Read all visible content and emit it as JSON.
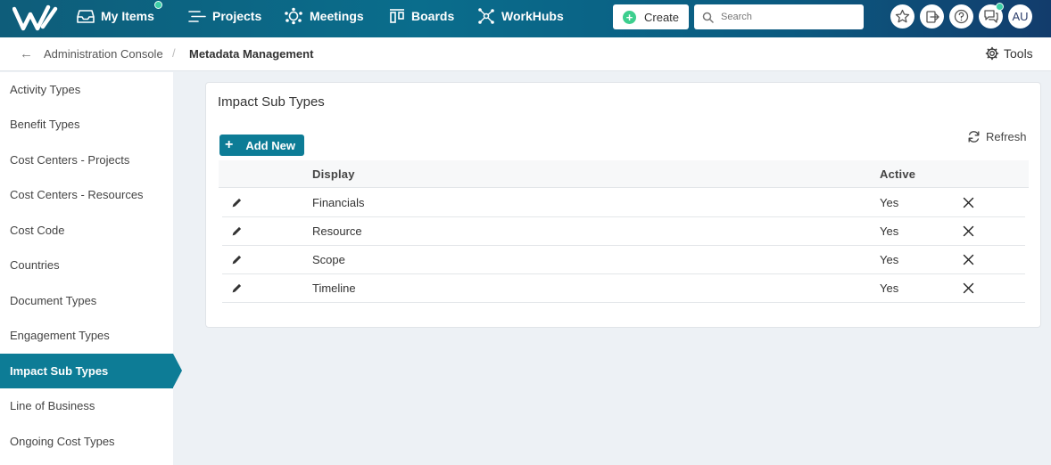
{
  "topbar": {
    "nav": {
      "my_items": "My Items",
      "projects": "Projects",
      "meetings": "Meetings",
      "boards": "Boards",
      "workhubs": "WorkHubs"
    },
    "create_label": "Create",
    "search_placeholder": "Search",
    "avatar_initials": "AU",
    "icons": [
      "star-icon",
      "logout-icon",
      "help-icon",
      "chat-icon"
    ]
  },
  "breadcrumb": {
    "parent": "Administration Console",
    "current": "Metadata Management",
    "tools_label": "Tools"
  },
  "sidebar": {
    "items": [
      {
        "label": "Activity Types"
      },
      {
        "label": "Benefit Types"
      },
      {
        "label": "Cost Centers - Projects"
      },
      {
        "label": "Cost Centers - Resources"
      },
      {
        "label": "Cost Code"
      },
      {
        "label": "Countries"
      },
      {
        "label": "Document Types"
      },
      {
        "label": "Engagement Types"
      },
      {
        "label": "Impact Sub Types",
        "active": true
      },
      {
        "label": "Line of Business"
      },
      {
        "label": "Ongoing Cost Types"
      }
    ]
  },
  "main": {
    "title": "Impact Sub Types",
    "add_label": "Add New",
    "refresh_label": "Refresh",
    "columns": {
      "display": "Display",
      "active": "Active"
    },
    "rows": [
      {
        "display": "Financials",
        "active": "Yes"
      },
      {
        "display": "Resource",
        "active": "Yes"
      },
      {
        "display": "Scope",
        "active": "Yes"
      },
      {
        "display": "Timeline",
        "active": "Yes"
      }
    ]
  },
  "colors": {
    "topbar": "#0a6d8c",
    "accent": "#0d7c96",
    "create_plus": "#3ccf8e",
    "notification_dot": "#3ccfa6"
  }
}
